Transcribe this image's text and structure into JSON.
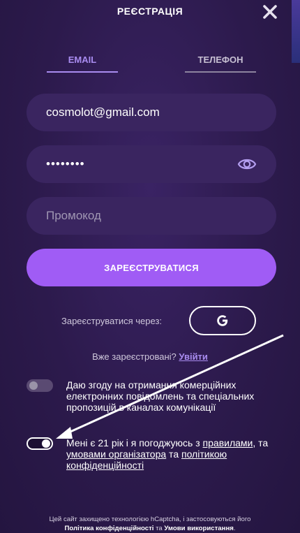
{
  "header": {
    "title": "РЕЄСТРАЦІЯ",
    "close_icon": "close-icon"
  },
  "tabs": [
    {
      "label": "EMAIL",
      "active": true
    },
    {
      "label": "ТЕЛЕФОН",
      "active": false
    }
  ],
  "form": {
    "email_value": "cosmolot@gmail.com",
    "password_mask": "••••••••",
    "promo_placeholder": "Промокод",
    "submit_label": "ЗАРЕЄСТРУВАТИСЯ"
  },
  "social": {
    "label": "Зареєструватися через:",
    "google_icon": "google-icon"
  },
  "already": {
    "text": "Вже зареєстровані? ",
    "login_link": "Увійти"
  },
  "consents": [
    {
      "text": "Даю згоду на отримання комерційних електронних повідомлень та спеціальних пропозицій в каналах комунікації",
      "enabled": false
    },
    {
      "text_before": "Мені є 21 рік і я погоджуюсь з ",
      "rules_link": "правилами",
      "text_mid": ", та ",
      "terms_link": "умовами організатора",
      "text_and": " та ",
      "privacy_link": "політикою конфіденційності",
      "enabled": true
    }
  ],
  "footer": {
    "text": "Цей сайт захищено технологією hCaptcha, і застосовуються його",
    "privacy_label": "Політика конфіденційності",
    "and": " та ",
    "terms_label": "Умови використання",
    "dot": "."
  },
  "colors": {
    "accent": "#a05cf5",
    "link": "#a98cf0",
    "background": "#2c1a4c"
  }
}
